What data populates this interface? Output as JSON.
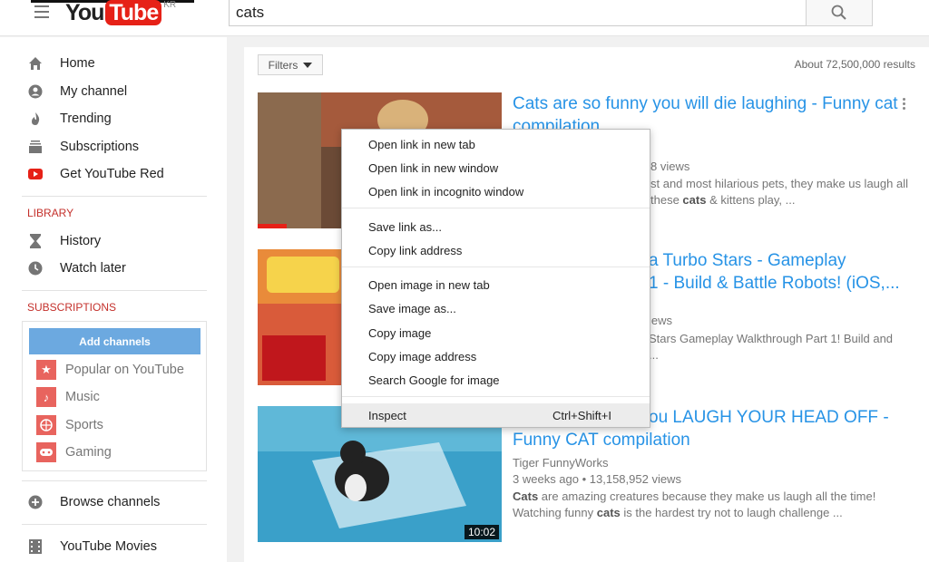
{
  "header": {
    "logo_you": "You",
    "logo_tube": "Tube",
    "logo_region": "KR",
    "search_value": "cats"
  },
  "sidebar": {
    "nav": [
      {
        "label": "Home",
        "icon": "home-icon"
      },
      {
        "label": "My channel",
        "icon": "account-icon"
      },
      {
        "label": "Trending",
        "icon": "flame-icon"
      },
      {
        "label": "Subscriptions",
        "icon": "subscriptions-icon"
      },
      {
        "label": "Get YouTube Red",
        "icon": "youtube-red-icon"
      }
    ],
    "library_title": "LIBRARY",
    "library": [
      {
        "label": "History",
        "icon": "hourglass-icon"
      },
      {
        "label": "Watch later",
        "icon": "clock-icon"
      }
    ],
    "subscriptions_title": "SUBSCRIPTIONS",
    "add_channels": "Add channels",
    "channels": [
      {
        "label": "Popular on YouTube",
        "icon": "star-icon"
      },
      {
        "label": "Music",
        "icon": "music-note-icon"
      },
      {
        "label": "Sports",
        "icon": "ball-icon"
      },
      {
        "label": "Gaming",
        "icon": "gamepad-icon"
      }
    ],
    "browse_channels": "Browse channels",
    "youtube_movies": "YouTube Movies"
  },
  "results": {
    "filters_label": "Filters",
    "count": "About 72,500,000 results",
    "videos": [
      {
        "title_line1": "Cats are so funny you will die laughing - Funny cat",
        "title_line2": "compilation",
        "meta": "8 views",
        "desc_line1": "st and most hilarious pets, they make us laugh all",
        "desc_line2_pre": "these ",
        "desc_line2_bold": "cats",
        "desc_line2_post": " & kittens play, ..."
      },
      {
        "title_line1": "a Turbo Stars - Gameplay",
        "title_line2": "1 - Build & Battle Robots! (iOS,...",
        "meta": "iews",
        "desc_line1": "Stars Gameplay Walkthrough Part 1! Build and",
        "desc_line2": "..."
      },
      {
        "title_line1": "ou LAUGH YOUR HEAD OFF -",
        "title_line2": "Funny CAT compilation",
        "channel": "Tiger FunnyWorks",
        "meta": "3 weeks ago • 13,158,952 views",
        "desc_line1_bold": "Cats",
        "desc_line1_post": " are amazing creatures because they make us laugh all the time!",
        "desc_line2_pre": "Watching funny ",
        "desc_line2_bold": "cats",
        "desc_line2_post": " is the hardest try not to laugh challenge ...",
        "duration": "10:02"
      }
    ]
  },
  "context_menu": {
    "items": [
      {
        "label": "Open link in new tab"
      },
      {
        "label": "Open link in new window"
      },
      {
        "label": "Open link in incognito window"
      },
      {
        "label": "Save link as..."
      },
      {
        "label": "Copy link address"
      },
      {
        "label": "Open image in new tab"
      },
      {
        "label": "Save image as..."
      },
      {
        "label": "Copy image"
      },
      {
        "label": "Copy image address"
      },
      {
        "label": "Search Google for image"
      },
      {
        "label": "Inspect",
        "shortcut": "Ctrl+Shift+I"
      }
    ]
  },
  "colors": {
    "accent_red": "#e62117",
    "link_blue": "#2793e6",
    "section_red": "#c4302b",
    "add_channels_blue": "#6ca9e0"
  }
}
